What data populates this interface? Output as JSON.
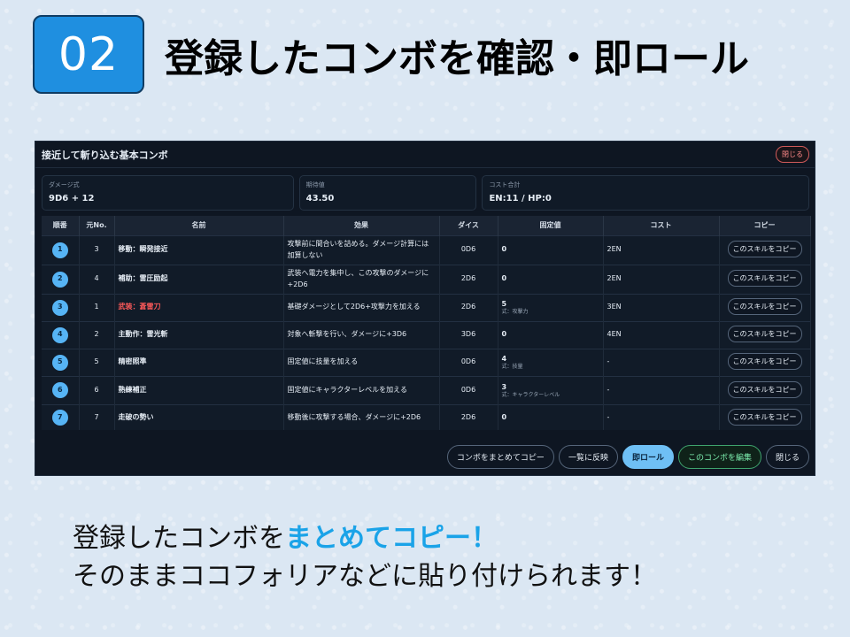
{
  "slide": {
    "step_number": "02",
    "title": "登録したコンボを確認・即ロール",
    "caption_line1_pre": "登録したコンボを",
    "caption_line1_accent": "まとめてコピー！",
    "caption_line2": "そのままココフォリアなどに貼り付けられます！",
    "accent_color": "#1aa3e8"
  },
  "app": {
    "title": "接近して斬り込む基本コンボ",
    "close_top_label": "閉じる",
    "summary": {
      "damage_label": "ダメージ式",
      "damage_value": "9D6 + 12",
      "expected_label": "期待値",
      "expected_value": "43.50",
      "cost_label": "コスト合計",
      "cost_value": "EN:11 / HP:0"
    },
    "columns": [
      "順番",
      "元No.",
      "名前",
      "効果",
      "ダイス",
      "固定値",
      "コスト",
      "コピー"
    ],
    "rows": [
      {
        "order": "1",
        "orig": "3",
        "name": "移動：瞬発接近",
        "effect": "攻撃前に間合いを詰める。ダメージ計算には加算しない",
        "dice": "0D6",
        "fixed": "0",
        "fixed_note": "",
        "cost": "2EN",
        "copy": "このスキルをコピー",
        "red": false
      },
      {
        "order": "2",
        "orig": "4",
        "name": "補助：雷圧励起",
        "effect": "武装へ電力を集中し、この攻撃のダメージに+2D6",
        "dice": "2D6",
        "fixed": "0",
        "fixed_note": "",
        "cost": "2EN",
        "copy": "このスキルをコピー",
        "red": false
      },
      {
        "order": "3",
        "orig": "1",
        "name": "武装：蒼雷刀",
        "effect": "基礎ダメージとして2D6+攻撃力を加える",
        "dice": "2D6",
        "fixed": "5",
        "fixed_note": "式：攻撃力",
        "cost": "3EN",
        "copy": "このスキルをコピー",
        "red": true
      },
      {
        "order": "4",
        "orig": "2",
        "name": "主動作：雷光斬",
        "effect": "対象へ斬撃を行い、ダメージに+3D6",
        "dice": "3D6",
        "fixed": "0",
        "fixed_note": "",
        "cost": "4EN",
        "copy": "このスキルをコピー",
        "red": false
      },
      {
        "order": "5",
        "orig": "5",
        "name": "精密照準",
        "effect": "固定値に技量を加える",
        "dice": "0D6",
        "fixed": "4",
        "fixed_note": "式：技量",
        "cost": "-",
        "copy": "このスキルをコピー",
        "red": false
      },
      {
        "order": "6",
        "orig": "6",
        "name": "熟練補正",
        "effect": "固定値にキャラクターレベルを加える",
        "dice": "0D6",
        "fixed": "3",
        "fixed_note": "式：キャラクターレベル",
        "cost": "-",
        "copy": "このスキルをコピー",
        "red": false
      },
      {
        "order": "7",
        "orig": "7",
        "name": "走破の勢い",
        "effect": "移動後に攻撃する場合、ダメージに+2D6",
        "dice": "2D6",
        "fixed": "0",
        "fixed_note": "",
        "cost": "-",
        "copy": "このスキルをコピー",
        "red": false
      }
    ],
    "footer": {
      "copy_all": "コンボをまとめてコピー",
      "reflect": "一覧に反映",
      "roll": "即ロール",
      "edit": "このコンボを編集",
      "close": "閉じる"
    }
  }
}
